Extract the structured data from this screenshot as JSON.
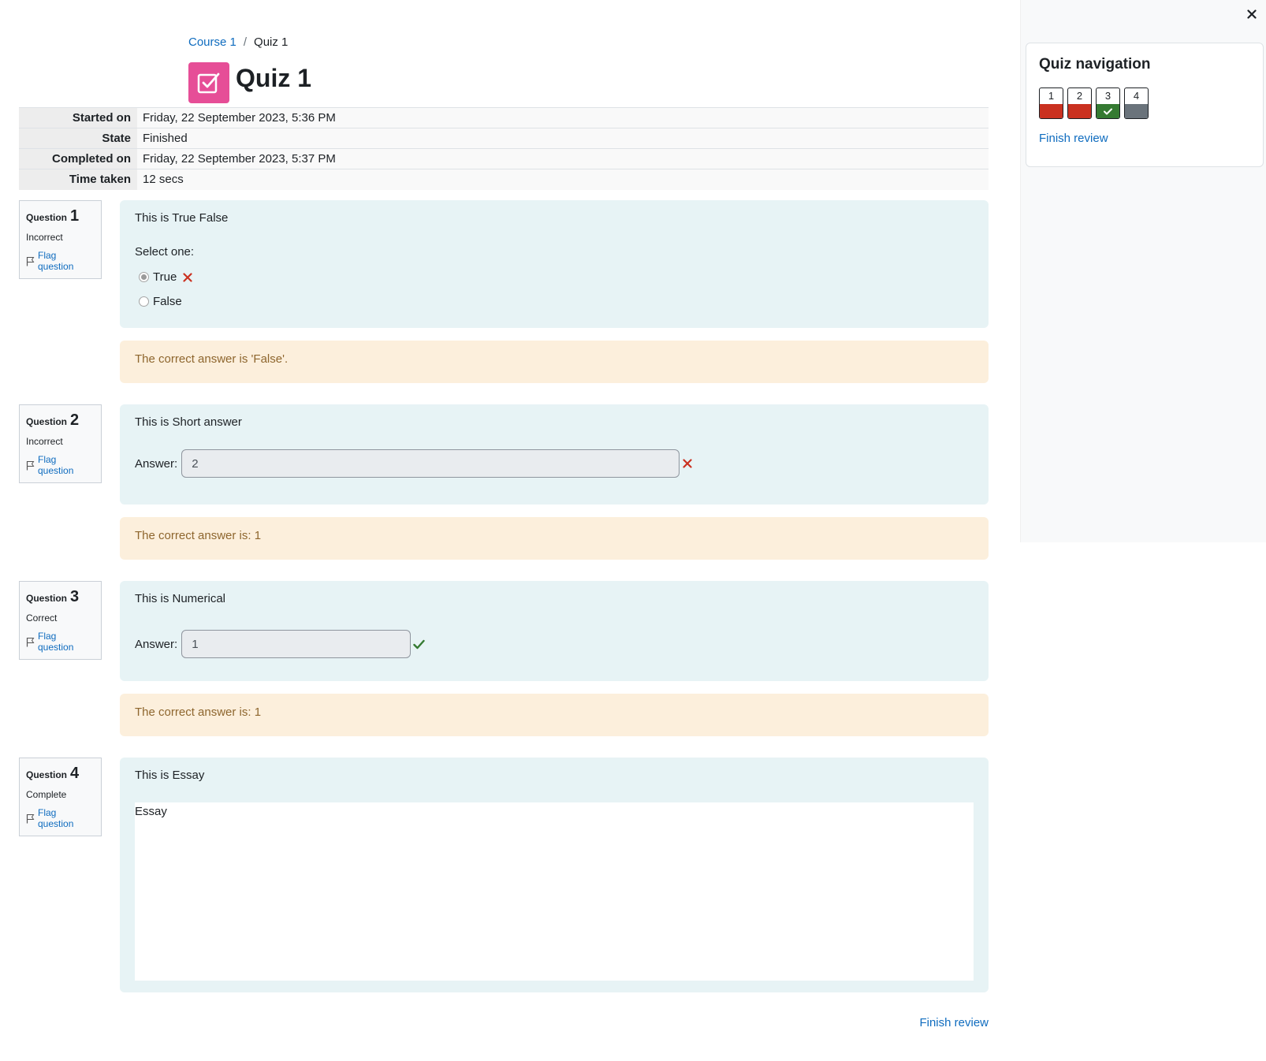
{
  "breadcrumb": {
    "course": "Course 1",
    "separator": "/",
    "current": "Quiz 1"
  },
  "page": {
    "title": "Quiz 1",
    "icon": "quiz-checkbox-icon",
    "icon_color": "#e64e97"
  },
  "summary": [
    {
      "label": "Started on",
      "value": "Friday, 22 September 2023, 5:36 PM"
    },
    {
      "label": "State",
      "value": "Finished"
    },
    {
      "label": "Completed on",
      "value": "Friday, 22 September 2023, 5:37 PM"
    },
    {
      "label": "Time taken",
      "value": "12 secs"
    }
  ],
  "questions": [
    {
      "label": "Question",
      "number": "1",
      "state": "Incorrect",
      "flag": "Flag question",
      "text": "This is True False",
      "prompt": "Select one:",
      "options": [
        {
          "label": "True",
          "checked": true,
          "mark": "incorrect"
        },
        {
          "label": "False",
          "checked": false
        }
      ],
      "feedback": "The correct answer is 'False'."
    },
    {
      "label": "Question",
      "number": "2",
      "state": "Incorrect",
      "flag": "Flag question",
      "text": "This is Short answer",
      "answer_label": "Answer:",
      "answer": "2",
      "mark": "incorrect",
      "feedback": "The correct answer is: 1"
    },
    {
      "label": "Question",
      "number": "3",
      "state": "Correct",
      "flag": "Flag question",
      "text": "This is Numerical",
      "answer_label": "Answer:",
      "answer": "1",
      "mark": "correct",
      "feedback": "The correct answer is: 1"
    },
    {
      "label": "Question",
      "number": "4",
      "state": "Complete",
      "flag": "Flag question",
      "text": "This is Essay",
      "response": "Essay"
    }
  ],
  "finish_review": "Finish review",
  "drawer": {
    "title": "Quiz navigation",
    "buttons": [
      {
        "number": "1",
        "status": "incorrect"
      },
      {
        "number": "2",
        "status": "incorrect"
      },
      {
        "number": "3",
        "status": "correct"
      },
      {
        "number": "4",
        "status": "complete"
      }
    ],
    "finish_review": "Finish review"
  },
  "colors": {
    "link": "#0f6cbf",
    "incorrect": "#ca3120",
    "correct": "#357a32",
    "complete": "#6a737b",
    "formulation_bg": "#e7f3f5",
    "feedback_bg": "#fcefdc",
    "feedback_text": "#8e662e"
  }
}
